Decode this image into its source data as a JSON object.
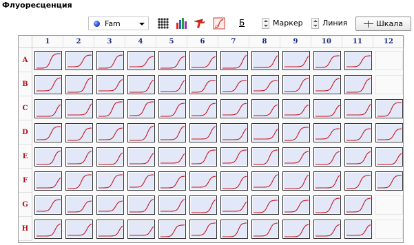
{
  "panel": {
    "title": "Флуоресценция"
  },
  "toolbar": {
    "dye": {
      "selected": "Fam",
      "color": "#1b3fd0"
    },
    "icons": [
      "plate-layout-icon",
      "bar-chart-icon",
      "pointer-icon",
      "curve-report-icon"
    ],
    "b_label": "Б",
    "marker_label": "Маркер",
    "line_label": "Линия",
    "scale_label": "Шкала"
  },
  "plate": {
    "columns": [
      "1",
      "2",
      "3",
      "4",
      "5",
      "6",
      "7",
      "8",
      "9",
      "10",
      "11",
      "12"
    ],
    "rows": [
      "A",
      "B",
      "C",
      "D",
      "E",
      "F",
      "G",
      "H"
    ],
    "filled_wells": {
      "A": [
        1,
        2,
        3,
        4,
        5,
        6,
        7,
        8,
        9,
        10,
        11
      ],
      "B": [
        1,
        2,
        3,
        4,
        5,
        6,
        7,
        8,
        9,
        10,
        11
      ],
      "C": [
        1,
        2,
        3,
        4,
        5,
        6,
        7,
        8,
        9,
        10,
        11,
        12
      ],
      "D": [
        1,
        2,
        3,
        4,
        5,
        6,
        7,
        8,
        9,
        10,
        11,
        12
      ],
      "E": [
        1,
        2,
        3,
        4,
        5,
        6,
        7,
        8,
        9,
        10,
        11,
        12
      ],
      "F": [
        1,
        2,
        3,
        4,
        5,
        6,
        7,
        8,
        9,
        10,
        11,
        12
      ],
      "G": [
        1,
        2,
        3,
        4,
        5,
        6,
        7,
        8,
        9,
        10,
        11
      ],
      "H": [
        1,
        2,
        3,
        4,
        5,
        6,
        7,
        8,
        9,
        10,
        11
      ]
    },
    "curve_color": "#c8141e",
    "well_background": "#e2e8f7"
  }
}
